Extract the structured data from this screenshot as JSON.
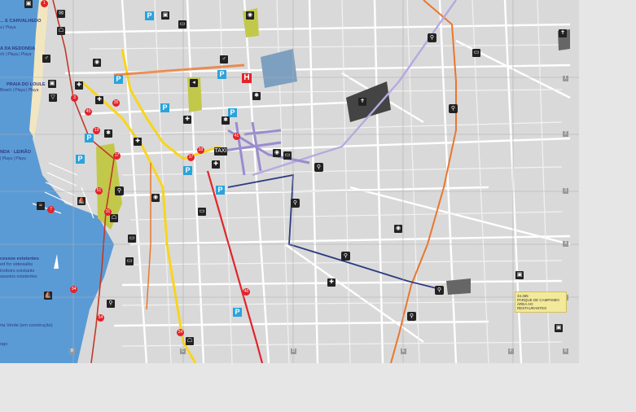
{
  "map": {
    "beach_labels": [
      "... E CARVALHEDO",
      "a | Playa",
      "A DA REDONDA",
      "ch | Playa | Playa",
      "PRAIA DO LOULE",
      "Beach | Playa | Playa",
      "NDA · LEIRÃO",
      "| Playa | Playa"
    ],
    "legend_lines": [
      "cessos existentes",
      "ed for sidewalks",
      "trottoirs existants",
      "asseios existentes",
      "rta Verde (em construção)",
      "ogo"
    ],
    "taxi_label": "TAXI",
    "hospital_label": "H",
    "parking_label": "P",
    "grid_labels": [
      "B",
      "C",
      "D",
      "E",
      "F",
      "1",
      "2",
      "3",
      "4",
      "5",
      "6"
    ],
    "note_lines": [
      "34.485",
      "PARQUE DE CAMPISMO",
      "ÁREA AO",
      "RESTAURANTES"
    ],
    "numbered_markers": [
      "1",
      "3",
      "7",
      "13",
      "17",
      "24",
      "31",
      "33",
      "34",
      "35",
      "37",
      "40",
      "41",
      "45",
      "51",
      "54"
    ],
    "colors": {
      "sea": "#5b9bd5",
      "land": "#d9d9d9",
      "road": "#ffffff",
      "route_yellow": "#f7d51e",
      "route_red": "#e2232a",
      "route_orange": "#e8772e",
      "route_blue": "#2d3a80",
      "route_purple": "#9a8ccf",
      "accent_green": "#c2c84a",
      "parking": "#2aa3dc"
    }
  }
}
